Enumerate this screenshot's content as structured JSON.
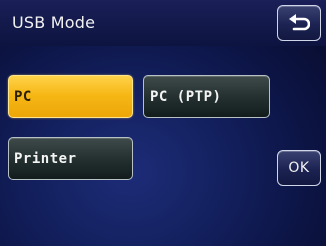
{
  "header": {
    "title": "USB Mode",
    "back_icon": "return-arrow-icon"
  },
  "modes": {
    "items": [
      {
        "label": "PC",
        "selected": true
      },
      {
        "label": "PC (PTP)",
        "selected": false
      },
      {
        "label": "Printer",
        "selected": false
      }
    ]
  },
  "actions": {
    "ok_label": "OK"
  },
  "colors": {
    "selected_fill": "#f6b816",
    "button_fill": "#253131",
    "background": "#13205e"
  }
}
